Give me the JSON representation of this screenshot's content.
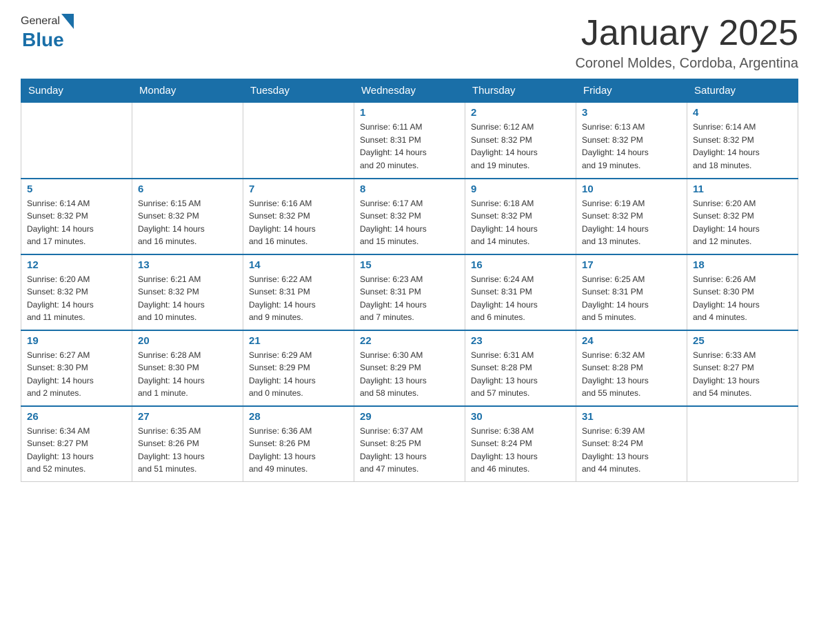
{
  "header": {
    "logo_general": "General",
    "logo_blue": "Blue",
    "title": "January 2025",
    "location": "Coronel Moldes, Cordoba, Argentina"
  },
  "weekdays": [
    "Sunday",
    "Monday",
    "Tuesday",
    "Wednesday",
    "Thursday",
    "Friday",
    "Saturday"
  ],
  "weeks": [
    [
      {
        "day": "",
        "info": ""
      },
      {
        "day": "",
        "info": ""
      },
      {
        "day": "",
        "info": ""
      },
      {
        "day": "1",
        "info": "Sunrise: 6:11 AM\nSunset: 8:31 PM\nDaylight: 14 hours\nand 20 minutes."
      },
      {
        "day": "2",
        "info": "Sunrise: 6:12 AM\nSunset: 8:32 PM\nDaylight: 14 hours\nand 19 minutes."
      },
      {
        "day": "3",
        "info": "Sunrise: 6:13 AM\nSunset: 8:32 PM\nDaylight: 14 hours\nand 19 minutes."
      },
      {
        "day": "4",
        "info": "Sunrise: 6:14 AM\nSunset: 8:32 PM\nDaylight: 14 hours\nand 18 minutes."
      }
    ],
    [
      {
        "day": "5",
        "info": "Sunrise: 6:14 AM\nSunset: 8:32 PM\nDaylight: 14 hours\nand 17 minutes."
      },
      {
        "day": "6",
        "info": "Sunrise: 6:15 AM\nSunset: 8:32 PM\nDaylight: 14 hours\nand 16 minutes."
      },
      {
        "day": "7",
        "info": "Sunrise: 6:16 AM\nSunset: 8:32 PM\nDaylight: 14 hours\nand 16 minutes."
      },
      {
        "day": "8",
        "info": "Sunrise: 6:17 AM\nSunset: 8:32 PM\nDaylight: 14 hours\nand 15 minutes."
      },
      {
        "day": "9",
        "info": "Sunrise: 6:18 AM\nSunset: 8:32 PM\nDaylight: 14 hours\nand 14 minutes."
      },
      {
        "day": "10",
        "info": "Sunrise: 6:19 AM\nSunset: 8:32 PM\nDaylight: 14 hours\nand 13 minutes."
      },
      {
        "day": "11",
        "info": "Sunrise: 6:20 AM\nSunset: 8:32 PM\nDaylight: 14 hours\nand 12 minutes."
      }
    ],
    [
      {
        "day": "12",
        "info": "Sunrise: 6:20 AM\nSunset: 8:32 PM\nDaylight: 14 hours\nand 11 minutes."
      },
      {
        "day": "13",
        "info": "Sunrise: 6:21 AM\nSunset: 8:32 PM\nDaylight: 14 hours\nand 10 minutes."
      },
      {
        "day": "14",
        "info": "Sunrise: 6:22 AM\nSunset: 8:31 PM\nDaylight: 14 hours\nand 9 minutes."
      },
      {
        "day": "15",
        "info": "Sunrise: 6:23 AM\nSunset: 8:31 PM\nDaylight: 14 hours\nand 7 minutes."
      },
      {
        "day": "16",
        "info": "Sunrise: 6:24 AM\nSunset: 8:31 PM\nDaylight: 14 hours\nand 6 minutes."
      },
      {
        "day": "17",
        "info": "Sunrise: 6:25 AM\nSunset: 8:31 PM\nDaylight: 14 hours\nand 5 minutes."
      },
      {
        "day": "18",
        "info": "Sunrise: 6:26 AM\nSunset: 8:30 PM\nDaylight: 14 hours\nand 4 minutes."
      }
    ],
    [
      {
        "day": "19",
        "info": "Sunrise: 6:27 AM\nSunset: 8:30 PM\nDaylight: 14 hours\nand 2 minutes."
      },
      {
        "day": "20",
        "info": "Sunrise: 6:28 AM\nSunset: 8:30 PM\nDaylight: 14 hours\nand 1 minute."
      },
      {
        "day": "21",
        "info": "Sunrise: 6:29 AM\nSunset: 8:29 PM\nDaylight: 14 hours\nand 0 minutes."
      },
      {
        "day": "22",
        "info": "Sunrise: 6:30 AM\nSunset: 8:29 PM\nDaylight: 13 hours\nand 58 minutes."
      },
      {
        "day": "23",
        "info": "Sunrise: 6:31 AM\nSunset: 8:28 PM\nDaylight: 13 hours\nand 57 minutes."
      },
      {
        "day": "24",
        "info": "Sunrise: 6:32 AM\nSunset: 8:28 PM\nDaylight: 13 hours\nand 55 minutes."
      },
      {
        "day": "25",
        "info": "Sunrise: 6:33 AM\nSunset: 8:27 PM\nDaylight: 13 hours\nand 54 minutes."
      }
    ],
    [
      {
        "day": "26",
        "info": "Sunrise: 6:34 AM\nSunset: 8:27 PM\nDaylight: 13 hours\nand 52 minutes."
      },
      {
        "day": "27",
        "info": "Sunrise: 6:35 AM\nSunset: 8:26 PM\nDaylight: 13 hours\nand 51 minutes."
      },
      {
        "day": "28",
        "info": "Sunrise: 6:36 AM\nSunset: 8:26 PM\nDaylight: 13 hours\nand 49 minutes."
      },
      {
        "day": "29",
        "info": "Sunrise: 6:37 AM\nSunset: 8:25 PM\nDaylight: 13 hours\nand 47 minutes."
      },
      {
        "day": "30",
        "info": "Sunrise: 6:38 AM\nSunset: 8:24 PM\nDaylight: 13 hours\nand 46 minutes."
      },
      {
        "day": "31",
        "info": "Sunrise: 6:39 AM\nSunset: 8:24 PM\nDaylight: 13 hours\nand 44 minutes."
      },
      {
        "day": "",
        "info": ""
      }
    ]
  ]
}
